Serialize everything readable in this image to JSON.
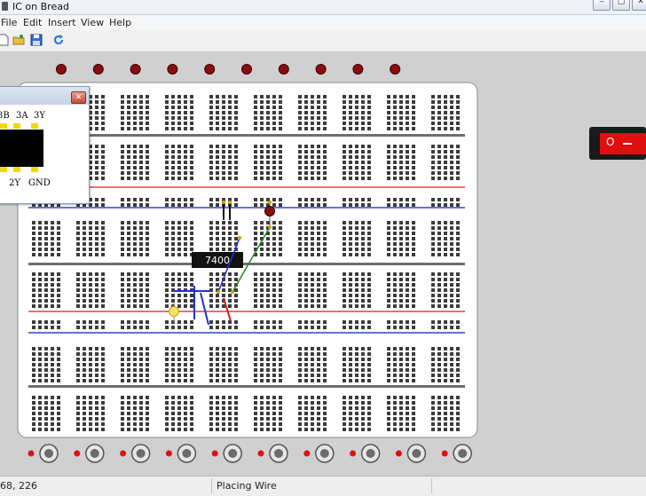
{
  "window": {
    "title": "IC on Bread"
  },
  "menu": {
    "file": "File",
    "edit": "Edit",
    "insert": "Insert",
    "view": "View",
    "help": "Help"
  },
  "toolbar": {
    "icons": [
      "new-file-icon",
      "open-folder-icon",
      "save-icon",
      "refresh-icon"
    ]
  },
  "popup": {
    "labels": [
      "3B",
      "3A",
      "3Y",
      "2Y",
      "GND"
    ]
  },
  "board": {
    "ic_label": "7400",
    "led_count": 10,
    "switch_count": 10
  },
  "power_switch": {
    "label": "O"
  },
  "colors": {
    "wire_blue": "#2233cc",
    "wire_green": "#1f8a1f",
    "wire_red": "#d01b1b",
    "rail_red": "#e04040",
    "rail_blue": "#3344bb",
    "led_red": "#8a0e0e"
  },
  "status": {
    "coords": "68, 226",
    "message": "Placing Wire"
  }
}
